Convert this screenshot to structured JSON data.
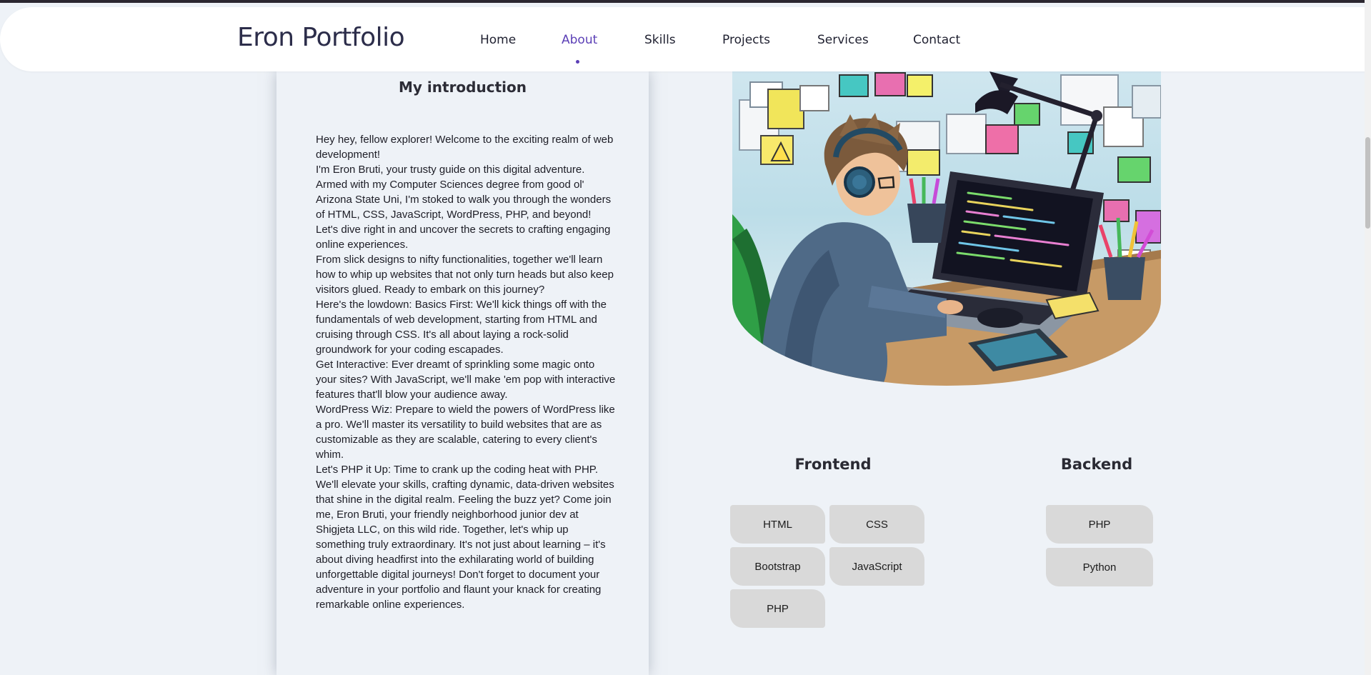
{
  "header": {
    "logo": "Eron Portfolio",
    "nav": [
      {
        "label": "Home",
        "active": false
      },
      {
        "label": "About",
        "active": true
      },
      {
        "label": "Skills",
        "active": false
      },
      {
        "label": "Projects",
        "active": false
      },
      {
        "label": "Services",
        "active": false
      },
      {
        "label": "Contact",
        "active": false
      }
    ]
  },
  "intro": {
    "title": "My introduction",
    "paragraphs": [
      "Hey hey, fellow explorer! Welcome to the exciting realm of web development!",
      "I'm Eron Bruti, your trusty guide on this digital adventure. Armed with my Computer Sciences degree from good ol' Arizona State Uni, I'm stoked to walk you through the wonders of HTML, CSS, JavaScript, WordPress, PHP, and beyond!",
      "Let's dive right in and uncover the secrets to crafting engaging online experiences.",
      "From slick designs to nifty functionalities, together we'll learn how to whip up websites that not only turn heads but also keep visitors glued. Ready to embark on this journey?",
      "Here's the lowdown: Basics First: We'll kick things off with the fundamentals of web development, starting from HTML and cruising through CSS. It's all about laying a rock-solid groundwork for your coding escapades.",
      "Get Interactive: Ever dreamt of sprinkling some magic onto your sites? With JavaScript, we'll make 'em pop with interactive features that'll blow your audience away.",
      "WordPress Wiz: Prepare to wield the powers of WordPress like a pro. We'll master its versatility to build websites that are as customizable as they are scalable, catering to every client's whim.",
      "Let's PHP it Up: Time to crank up the coding heat with PHP. We'll elevate your skills, crafting dynamic, data-driven websites that shine in the digital realm. Feeling the buzz yet? Come join me, Eron Bruti, your friendly neighborhood junior dev at Shigjeta LLC, on this wild ride. Together, let's whip up something truly extraordinary. It's not just about learning – it's about diving headfirst into the exhilarating world of building unforgettable digital journeys! Don't forget to document your adventure in your portfolio and flaunt your knack for creating remarkable online experiences."
    ]
  },
  "skills": {
    "frontend": {
      "title": "Frontend",
      "items": [
        "HTML",
        "CSS",
        "Bootstrap",
        "JavaScript",
        "PHP"
      ]
    },
    "backend": {
      "title": "Backend",
      "items": [
        "PHP",
        "Python"
      ]
    }
  },
  "colors": {
    "accent": "#5b3fb6",
    "background": "#eef2f7",
    "button": "#d9d9d9"
  }
}
